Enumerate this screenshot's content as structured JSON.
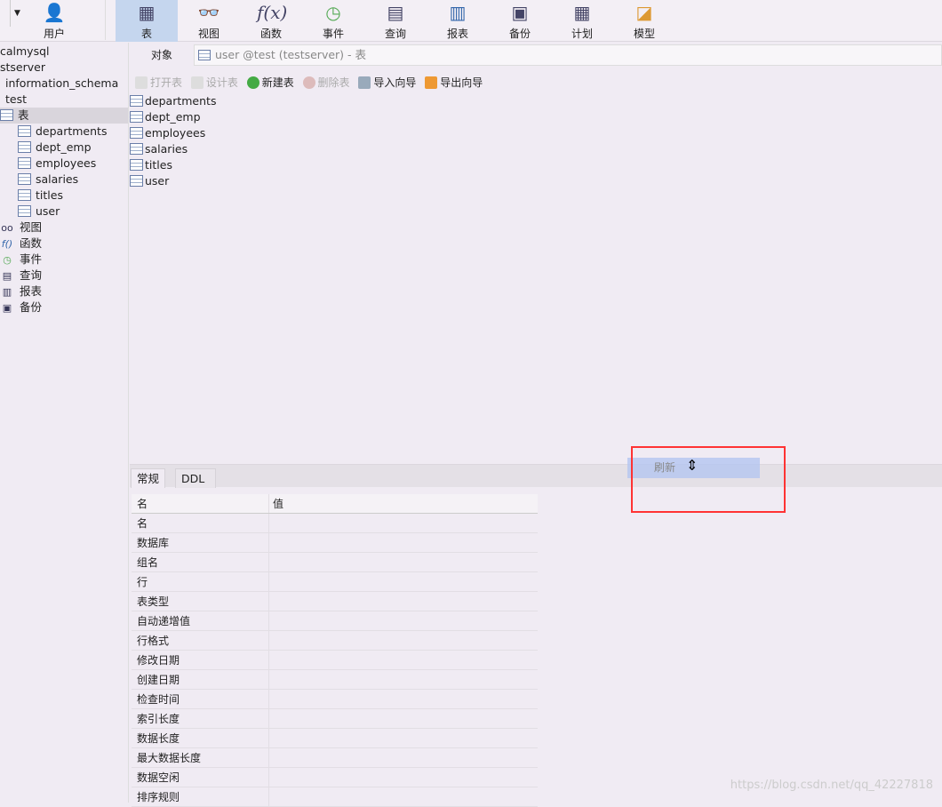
{
  "toolbar": {
    "items": [
      {
        "label": "用户",
        "icon": "user-icon"
      },
      {
        "label": "表",
        "icon": "table-icon",
        "selected": true
      },
      {
        "label": "视图",
        "icon": "view-icon"
      },
      {
        "label": "函数",
        "icon": "function-icon"
      },
      {
        "label": "事件",
        "icon": "event-icon"
      },
      {
        "label": "查询",
        "icon": "query-icon"
      },
      {
        "label": "报表",
        "icon": "report-icon"
      },
      {
        "label": "备份",
        "icon": "backup-icon"
      },
      {
        "label": "计划",
        "icon": "schedule-icon"
      },
      {
        "label": "模型",
        "icon": "model-icon"
      }
    ]
  },
  "sidebar": {
    "connections": [
      "calmysql",
      "stserver"
    ],
    "databases": [
      "information_schema",
      "test"
    ],
    "tables_label": "表",
    "tables": [
      "departments",
      "dept_emp",
      "employees",
      "salaries",
      "titles",
      "user"
    ],
    "others": [
      {
        "label": "视图",
        "icon": "view-icon"
      },
      {
        "label": "函数",
        "icon": "function-icon"
      },
      {
        "label": "事件",
        "icon": "event-icon"
      },
      {
        "label": "查询",
        "icon": "query-icon"
      },
      {
        "label": "报表",
        "icon": "report-icon"
      },
      {
        "label": "备份",
        "icon": "backup-icon"
      }
    ]
  },
  "object_tab": {
    "label": "对象",
    "field": "user @test (testserver) - 表"
  },
  "actions": {
    "open": "打开表",
    "design": "设计表",
    "new": "新建表",
    "delete": "删除表",
    "import": "导入向导",
    "export": "导出向导"
  },
  "list": [
    "departments",
    "dept_emp",
    "employees",
    "salaries",
    "titles",
    "user"
  ],
  "tabs": {
    "general": "常规",
    "ddl": "DDL"
  },
  "grid": {
    "headers": [
      "名",
      "值"
    ],
    "rows": [
      "名",
      "数据库",
      "组名",
      "行",
      "表类型",
      "自动递增值",
      "行格式",
      "修改日期",
      "创建日期",
      "检查时间",
      "索引长度",
      "数据长度",
      "最大数据长度",
      "数据空闲",
      "排序规则"
    ]
  },
  "drag": {
    "label": "刷新"
  },
  "watermark": "https://blog.csdn.net/qq_42227818"
}
